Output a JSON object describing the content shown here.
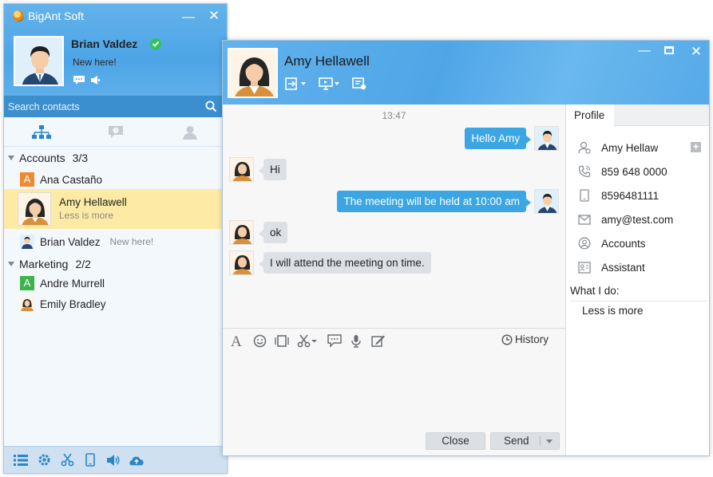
{
  "main_window": {
    "app_title": "BigAnt Soft",
    "user": {
      "name": "Brian Valdez",
      "signature": "New here!"
    },
    "search": {
      "placeholder": "Search contacts"
    },
    "groups": [
      {
        "name": "Accounts",
        "count": "3/3"
      },
      {
        "name": "Marketing",
        "count": "2/2"
      }
    ],
    "contacts": [
      {
        "name": "Ana Castaño",
        "initial": "A",
        "color": "#f08a2e"
      },
      {
        "name": "Amy Hellawell",
        "signature": "Less is more"
      },
      {
        "name": "Brian Valdez",
        "signature": "New here!"
      },
      {
        "name": "Andre Murrell",
        "initial": "A",
        "color": "#3cb44b"
      },
      {
        "name": "Emily Bradley"
      }
    ]
  },
  "chat_window": {
    "peer_name": "Amy Hellawell",
    "time": "13:47",
    "messages": [
      {
        "from": "me",
        "text": "Hello Amy"
      },
      {
        "from": "peer",
        "text": "Hi"
      },
      {
        "from": "me",
        "text": "The meeting will be held at 10:00 am"
      },
      {
        "from": "peer",
        "text": "ok"
      },
      {
        "from": "peer",
        "text": "I will attend the meeting on time."
      }
    ],
    "history_label": "History",
    "close_label": "Close",
    "send_label": "Send"
  },
  "profile": {
    "tab_label": "Profile",
    "display_name": "Amy Hellaw",
    "phone": "859 648 0000",
    "mobile": "8596481111",
    "email": "amy@test.com",
    "department": "Accounts",
    "position": "Assistant",
    "what_i_do_label": "What I do:",
    "what_i_do": "Less is more"
  },
  "colors": {
    "header_blue": "#4da5e6",
    "search_blue": "#3c8fcf",
    "selected_row": "#fdeaa4",
    "outgoing_bubble": "#3ba6e3",
    "incoming_bubble": "#dde1e6",
    "online_green": "#2fc35a"
  }
}
